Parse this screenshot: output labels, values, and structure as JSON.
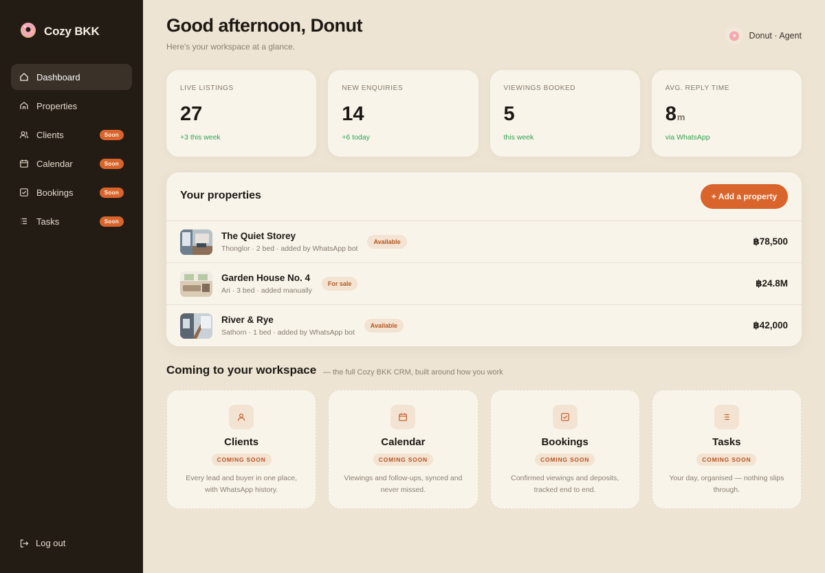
{
  "brand": {
    "name": "Cozy BKK",
    "logo_icon": "donut-icon"
  },
  "sidebar": {
    "items": [
      {
        "label": "Dashboard",
        "icon": "home-icon",
        "active": true,
        "badge": ""
      },
      {
        "label": "Properties",
        "icon": "building-icon",
        "active": false,
        "badge": ""
      },
      {
        "label": "Clients",
        "icon": "users-icon",
        "active": false,
        "badge": "Soon"
      },
      {
        "label": "Calendar",
        "icon": "calendar-icon",
        "active": false,
        "badge": "Soon"
      },
      {
        "label": "Bookings",
        "icon": "check-square-icon",
        "active": false,
        "badge": "Soon"
      },
      {
        "label": "Tasks",
        "icon": "list-icon",
        "active": false,
        "badge": "Soon"
      }
    ],
    "logout_label": "Log out"
  },
  "header": {
    "greeting": "Good afternoon, Donut",
    "subtitle": "Here's your workspace at a glance.",
    "user_label": "Donut · Agent"
  },
  "stats": [
    {
      "label": "LIVE LISTINGS",
      "value": "27",
      "unit": "",
      "delta": "+3 this week"
    },
    {
      "label": "NEW ENQUIRIES",
      "value": "14",
      "unit": "",
      "delta": "+6 today"
    },
    {
      "label": "VIEWINGS BOOKED",
      "value": "5",
      "unit": "",
      "delta": "this week"
    },
    {
      "label": "AVG. REPLY TIME",
      "value": "8",
      "unit": "m",
      "delta": "via WhatsApp"
    }
  ],
  "properties": {
    "title": "Your properties",
    "add_label": "+ Add a property",
    "rows": [
      {
        "name": "The Quiet Storey",
        "meta": "Thonglor · 2 bed · added by WhatsApp bot",
        "status": "Available",
        "price": "฿78,500"
      },
      {
        "name": "Garden House No. 4",
        "meta": "Ari · 3 bed · added manually",
        "status": "For sale",
        "price": "฿24.8M"
      },
      {
        "name": "River & Rye",
        "meta": "Sathorn · 1 bed · added by WhatsApp bot",
        "status": "Available",
        "price": "฿42,000"
      }
    ]
  },
  "coming": {
    "title": "Coming to your workspace",
    "subtitle": "— the full Cozy BKK CRM, built around how you work",
    "features": [
      {
        "name": "Clients",
        "pill": "COMING SOON",
        "desc": "Every lead and buyer in one place, with WhatsApp history.",
        "icon": "user-icon"
      },
      {
        "name": "Calendar",
        "pill": "COMING SOON",
        "desc": "Viewings and follow-ups, synced and never missed.",
        "icon": "calendar-icon"
      },
      {
        "name": "Bookings",
        "pill": "COMING SOON",
        "desc": "Confirmed viewings and deposits, tracked end to end.",
        "icon": "check-square-icon"
      },
      {
        "name": "Tasks",
        "pill": "COMING SOON",
        "desc": "Your day, organised — nothing slips through.",
        "icon": "list-icon"
      }
    ]
  },
  "colors": {
    "accent": "#D9652C",
    "sidebar": "#231C15",
    "background": "#EDE4D3",
    "card": "#F8F4EA",
    "positive": "#2FA24E"
  }
}
